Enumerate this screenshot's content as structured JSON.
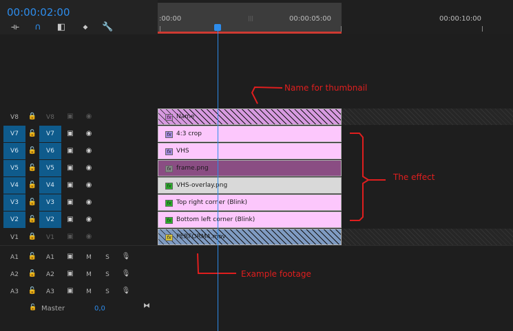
{
  "header": {
    "timecode": "00:00:02:00",
    "tools": [
      {
        "name": "insert-overwrite-icon",
        "glyph": "⟛"
      },
      {
        "name": "magnet-snap-icon",
        "glyph": "∩"
      },
      {
        "name": "linked-selection-icon",
        "glyph": "◧"
      },
      {
        "name": "marker-icon",
        "glyph": "◆"
      },
      {
        "name": "wrench-icon",
        "glyph": "🔧"
      }
    ]
  },
  "ruler": {
    "labels": [
      ":00:00",
      "00:00:05:00",
      "00:00:10:00"
    ],
    "grip": "|||"
  },
  "video_tracks": [
    {
      "id": "V8",
      "target": "V8",
      "active": false
    },
    {
      "id": "V7",
      "target": "V7",
      "active": true
    },
    {
      "id": "V6",
      "target": "V6",
      "active": true
    },
    {
      "id": "V5",
      "target": "V5",
      "active": true
    },
    {
      "id": "V4",
      "target": "V4",
      "active": true
    },
    {
      "id": "V3",
      "target": "V3",
      "active": true
    },
    {
      "id": "V2",
      "target": "V2",
      "active": true
    },
    {
      "id": "V1",
      "target": "V1",
      "active": false
    }
  ],
  "audio_tracks": [
    {
      "id": "A1",
      "target": "A1",
      "mute": "M",
      "solo": "S"
    },
    {
      "id": "A2",
      "target": "A2",
      "mute": "M",
      "solo": "S"
    },
    {
      "id": "A3",
      "target": "A3",
      "mute": "M",
      "solo": "S"
    }
  ],
  "master": {
    "label": "Master",
    "value": "0,0"
  },
  "clips": [
    {
      "track": "V8",
      "name": "Name",
      "fx": "fx",
      "color": "#d79ae0",
      "fx_color": "#c57bd4",
      "hatched": true
    },
    {
      "track": "V7",
      "name": "4:3 crop",
      "fx": "fx",
      "color": "#fcc7fc",
      "fx_color": "#a58be0"
    },
    {
      "track": "V6",
      "name": "VHS",
      "fx": "fx",
      "color": "#fcc7fc",
      "fx_color": "#a58be0"
    },
    {
      "track": "V5",
      "name": "frame.png",
      "fx": "fx",
      "color": "#8a4d83",
      "fx_color": "#8a8a8a"
    },
    {
      "track": "V4",
      "name": "VHS-overlay.png",
      "fx": "fx",
      "color": "#d9d9d9",
      "fx_color": "#2db02d"
    },
    {
      "track": "V3",
      "name": "Top right corner (Blink)",
      "fx": "fx",
      "color": "#fcc7fc",
      "fx_color": "#2db02d"
    },
    {
      "track": "V2",
      "name": "Bottom left corner (Blink)",
      "fx": "fx",
      "color": "#fcc7fc",
      "fx_color": "#2db02d"
    },
    {
      "track": "V1",
      "name": "PERFORM4.mov",
      "fx": "fx",
      "color": "#7f9bc2",
      "fx_color": "#d4c23a",
      "hatched": true
    }
  ],
  "annotations": {
    "thumbnail": "Name for thumbnail",
    "effect": "The effect",
    "footage": "Example footage"
  },
  "colors": {
    "accent": "#2d8ceb",
    "annotation": "#e01e1e",
    "track_target": "#0f5b8c"
  }
}
